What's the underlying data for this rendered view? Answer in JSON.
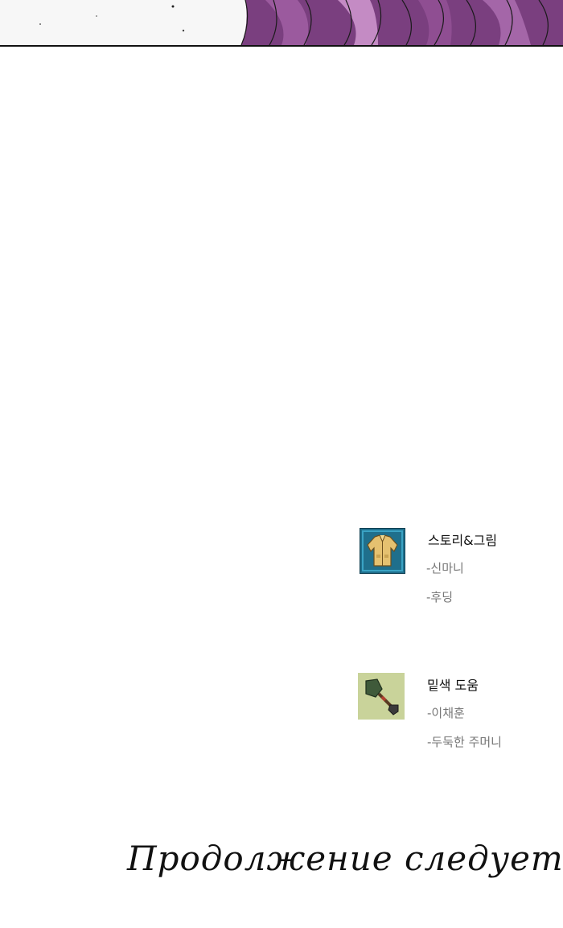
{
  "credits": [
    {
      "icon": "jacket-icon",
      "role": "스토리&그림",
      "names": [
        "-신마니",
        "-후딩"
      ]
    },
    {
      "icon": "shovel-icon",
      "role": "밑색 도움",
      "names": [
        "-이채훈",
        "-두둑한 주머니"
      ]
    }
  ],
  "footer": {
    "to_be_continued": "Продолжение следует"
  },
  "colors": {
    "panel_purple": "#7a3f7f",
    "jacket_bg": "#1f6f8c",
    "shovel_bg": "#c9d39a"
  }
}
